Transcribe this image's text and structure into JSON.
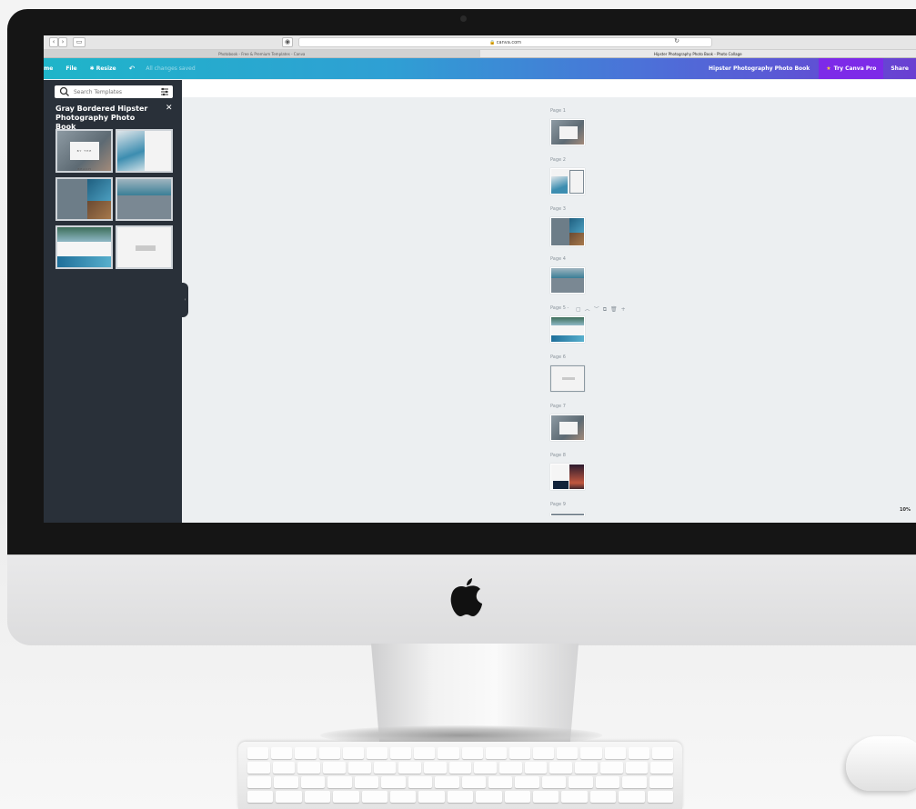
{
  "browser": {
    "url": "canva.com",
    "tabs": [
      {
        "label": "Photobook - Free & Premium Templates - Canva",
        "active": false
      },
      {
        "label": "Hipster Photography Photo Book - Photo Collage",
        "active": true
      }
    ]
  },
  "header": {
    "home": "me",
    "file": "File",
    "resize": "Resize",
    "saved": "All changes saved",
    "doc_title": "Hipster Photography Photo Book",
    "try_pro": "Try Canva Pro",
    "share": "Share"
  },
  "sidebar": {
    "search_placeholder": "Search Templates",
    "title": "Gray Bordered Hipster Photography Photo Book",
    "thumb1_text": "BY THE BEACH"
  },
  "pages": [
    "Page 1",
    "Page 2",
    "Page 3",
    "Page 4",
    "Page 5 -",
    "Page 6",
    "Page 7",
    "Page 8",
    "Page 9"
  ],
  "zoom": "10%",
  "colors": {
    "header_start": "#1fb5c9",
    "header_end": "#6a3fd2",
    "sidebar": "#293039",
    "canvas": "#eceff1"
  }
}
